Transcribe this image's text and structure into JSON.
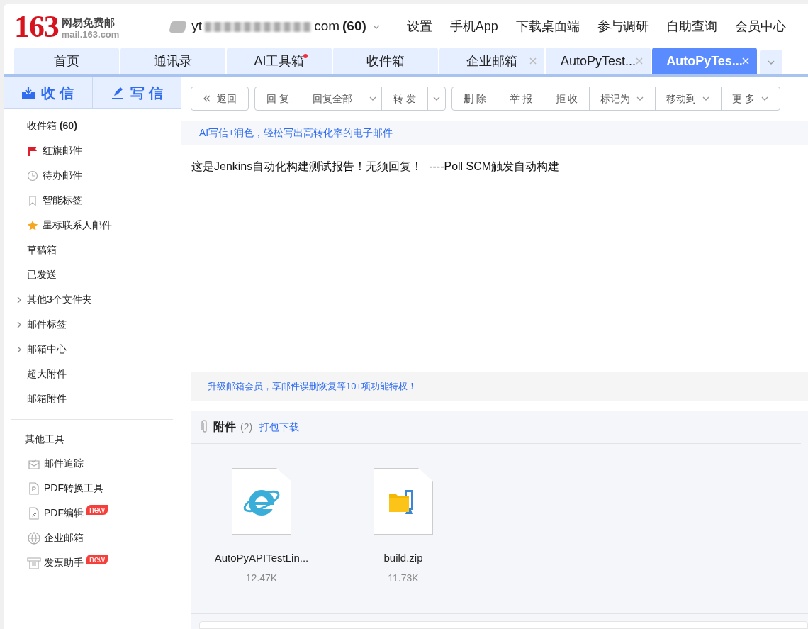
{
  "logo": {
    "number": "163",
    "name": "网易免费邮",
    "domain": "mail.163.com"
  },
  "account": {
    "prefix": "yt",
    "suffix": "com",
    "count": "(60)"
  },
  "top_links": [
    "设置",
    "手机App",
    "下载桌面端",
    "参与调研",
    "自助查询",
    "会员中心"
  ],
  "tabs": [
    {
      "label": "首页",
      "selected": false,
      "closable": false,
      "dot": false
    },
    {
      "label": "通讯录",
      "selected": false,
      "closable": false,
      "dot": false
    },
    {
      "label": "AI工具箱",
      "selected": false,
      "closable": false,
      "dot": true
    },
    {
      "label": "收件箱",
      "selected": false,
      "closable": false,
      "dot": false
    },
    {
      "label": "企业邮箱",
      "selected": false,
      "closable": true,
      "dot": false
    },
    {
      "label": "AutoPyTest...",
      "selected": false,
      "closable": true,
      "dot": false
    },
    {
      "label": "AutoPyTes...",
      "selected": true,
      "closable": true,
      "dot": false
    }
  ],
  "actions": {
    "receive": "收 信",
    "compose": "写 信"
  },
  "sidebar": {
    "folders": [
      {
        "label": "收件箱",
        "count": "(60)",
        "kind": "plain"
      },
      {
        "label": "红旗邮件",
        "kind": "icon"
      },
      {
        "label": "待办邮件",
        "kind": "icon"
      },
      {
        "label": "智能标签",
        "kind": "icon"
      },
      {
        "label": "星标联系人邮件",
        "kind": "icon"
      },
      {
        "label": "草稿箱",
        "kind": "plain"
      },
      {
        "label": "已发送",
        "kind": "plain"
      },
      {
        "label": "其他3个文件夹",
        "kind": "expandable",
        "expanded": false
      },
      {
        "label": "邮件标签",
        "kind": "expandable",
        "expanded": false
      },
      {
        "label": "邮箱中心",
        "kind": "expandable",
        "expanded": false
      },
      {
        "label": "超大附件",
        "kind": "plain"
      },
      {
        "label": "邮箱附件",
        "kind": "plain"
      }
    ],
    "tools_title": "其他工具",
    "tools": [
      {
        "label": "邮件追踪"
      },
      {
        "label": "PDF转换工具"
      },
      {
        "label": "PDF编辑",
        "badge": "new"
      },
      {
        "label": "企业邮箱"
      },
      {
        "label": "发票助手",
        "badge": "new"
      }
    ]
  },
  "toolbar": [
    [
      {
        "label": "返回",
        "kind": "back"
      }
    ],
    [
      {
        "label": "回 复",
        "kind": "button"
      },
      {
        "label": "回复全部",
        "kind": "button"
      },
      {
        "kind": "caret"
      },
      {
        "label": "转 发",
        "kind": "button"
      },
      {
        "kind": "caret"
      }
    ],
    [
      {
        "label": "删 除",
        "kind": "button"
      },
      {
        "label": "举 报",
        "kind": "button"
      },
      {
        "label": "拒 收",
        "kind": "button"
      },
      {
        "label": "标记为",
        "kind": "menu"
      },
      {
        "label": "移动到",
        "kind": "menu"
      },
      {
        "label": "更 多",
        "kind": "menu"
      }
    ]
  ],
  "ai_banner": "AI写信+润色，轻松写出高转化率的电子邮件",
  "body": "这是Jenkins自动化构建测试报告！无须回复！  ----Poll SCM触发自动构建",
  "upgrade_banner": "升级邮箱会员，享邮件误删恢复等10+项功能特权！",
  "attachments": {
    "title": "附件",
    "count": "(2)",
    "download_all": "打包下载",
    "files": [
      {
        "name": "AutoPyAPITestLin...",
        "size": "12.47K"
      },
      {
        "name": "build.zip",
        "size": "11.73K"
      }
    ]
  }
}
